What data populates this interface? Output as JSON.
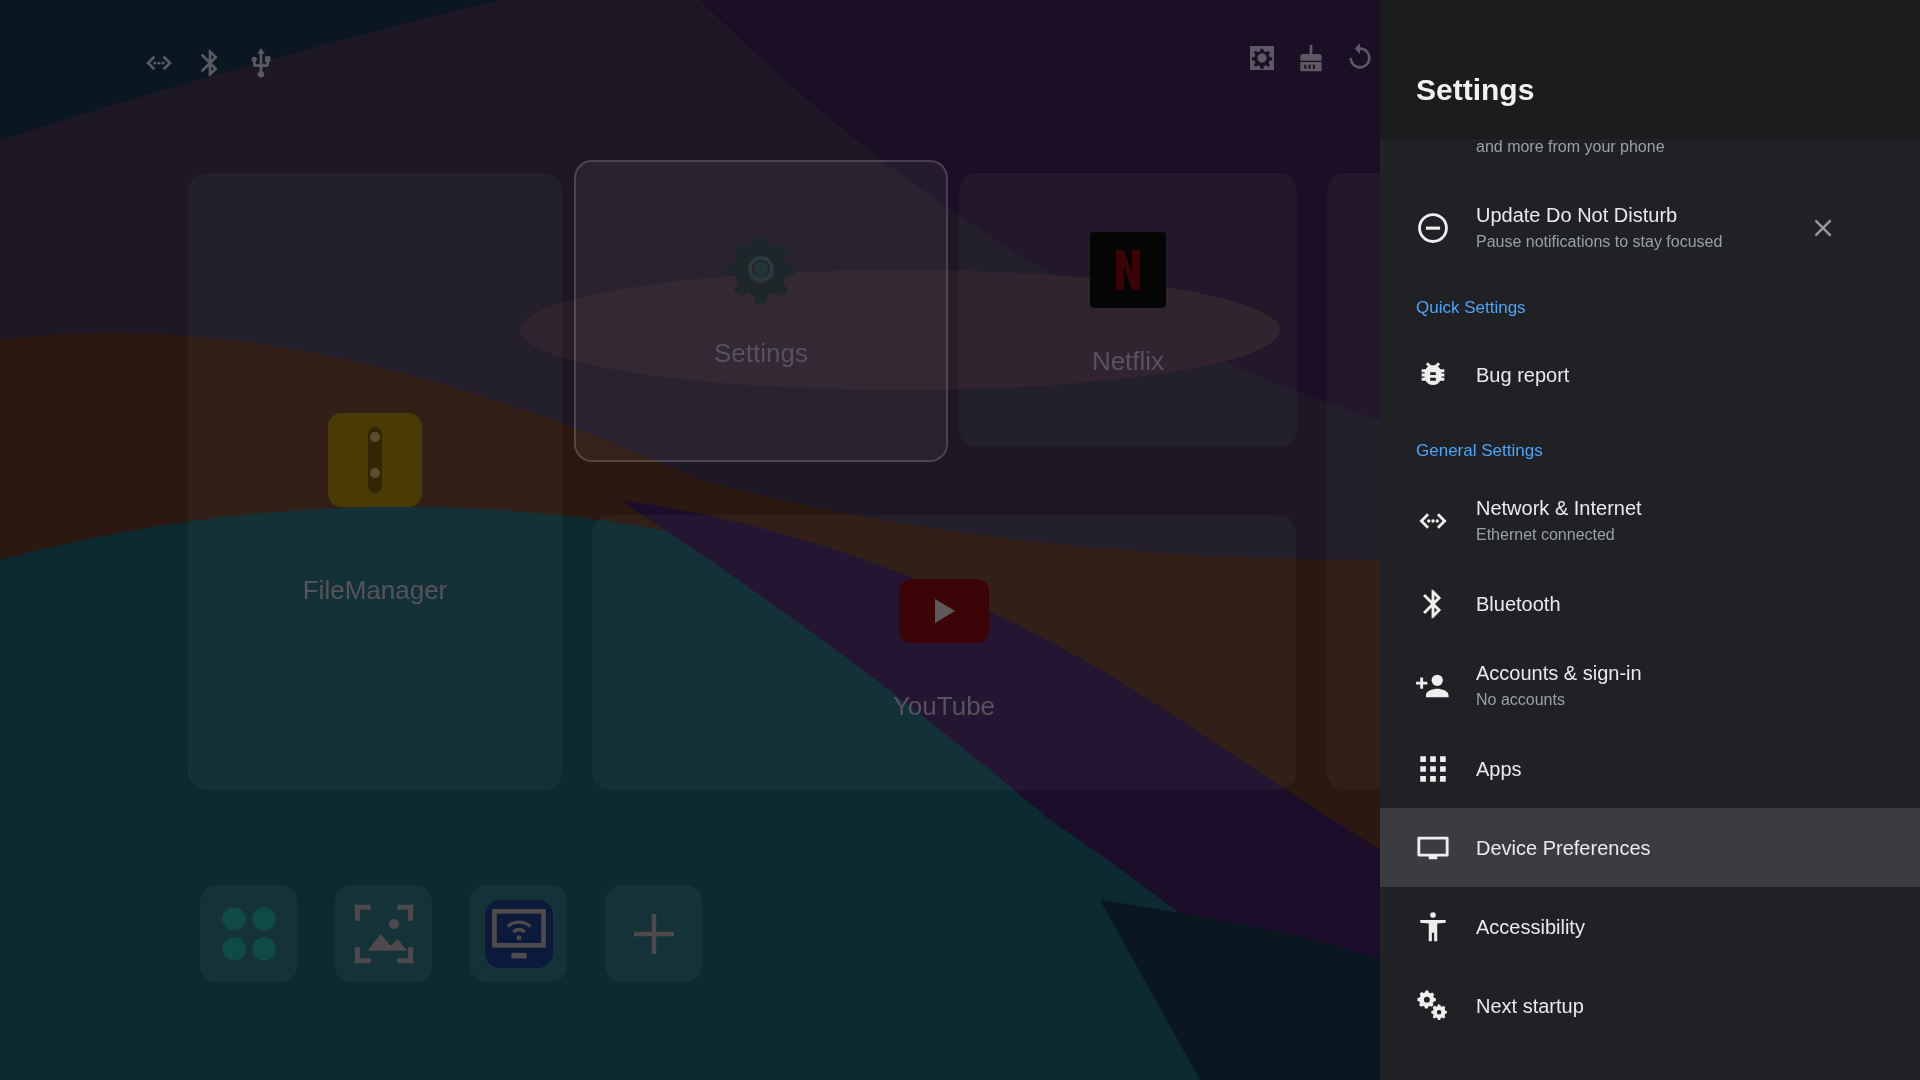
{
  "launcher": {
    "apps": [
      {
        "label": "FileManager",
        "focused": false
      },
      {
        "label": "Settings",
        "focused": true
      },
      {
        "label": "Netflix",
        "focused": false
      },
      {
        "label": "YouTube",
        "focused": false
      }
    ]
  },
  "settings_panel": {
    "title": "Settings",
    "items": [
      {
        "kind": "subtext",
        "text": "and more from your phone"
      },
      {
        "kind": "suggestion",
        "title": "Update Do Not Disturb",
        "summary": "Pause notifications to stay focused",
        "selected": false
      },
      {
        "kind": "header",
        "text": "Quick Settings"
      },
      {
        "kind": "item",
        "title": "Bug report",
        "selected": false
      },
      {
        "kind": "header",
        "text": "General Settings"
      },
      {
        "kind": "item",
        "title": "Network & Internet",
        "summary": "Ethernet connected",
        "selected": false
      },
      {
        "kind": "item",
        "title": "Bluetooth",
        "selected": false
      },
      {
        "kind": "item",
        "title": "Accounts & sign-in",
        "summary": "No accounts",
        "selected": false
      },
      {
        "kind": "item",
        "title": "Apps",
        "selected": false
      },
      {
        "kind": "item",
        "title": "Device Preferences",
        "selected": true
      },
      {
        "kind": "item",
        "title": "Accessibility",
        "selected": false
      },
      {
        "kind": "item",
        "title": "Next startup",
        "selected": false
      }
    ]
  }
}
